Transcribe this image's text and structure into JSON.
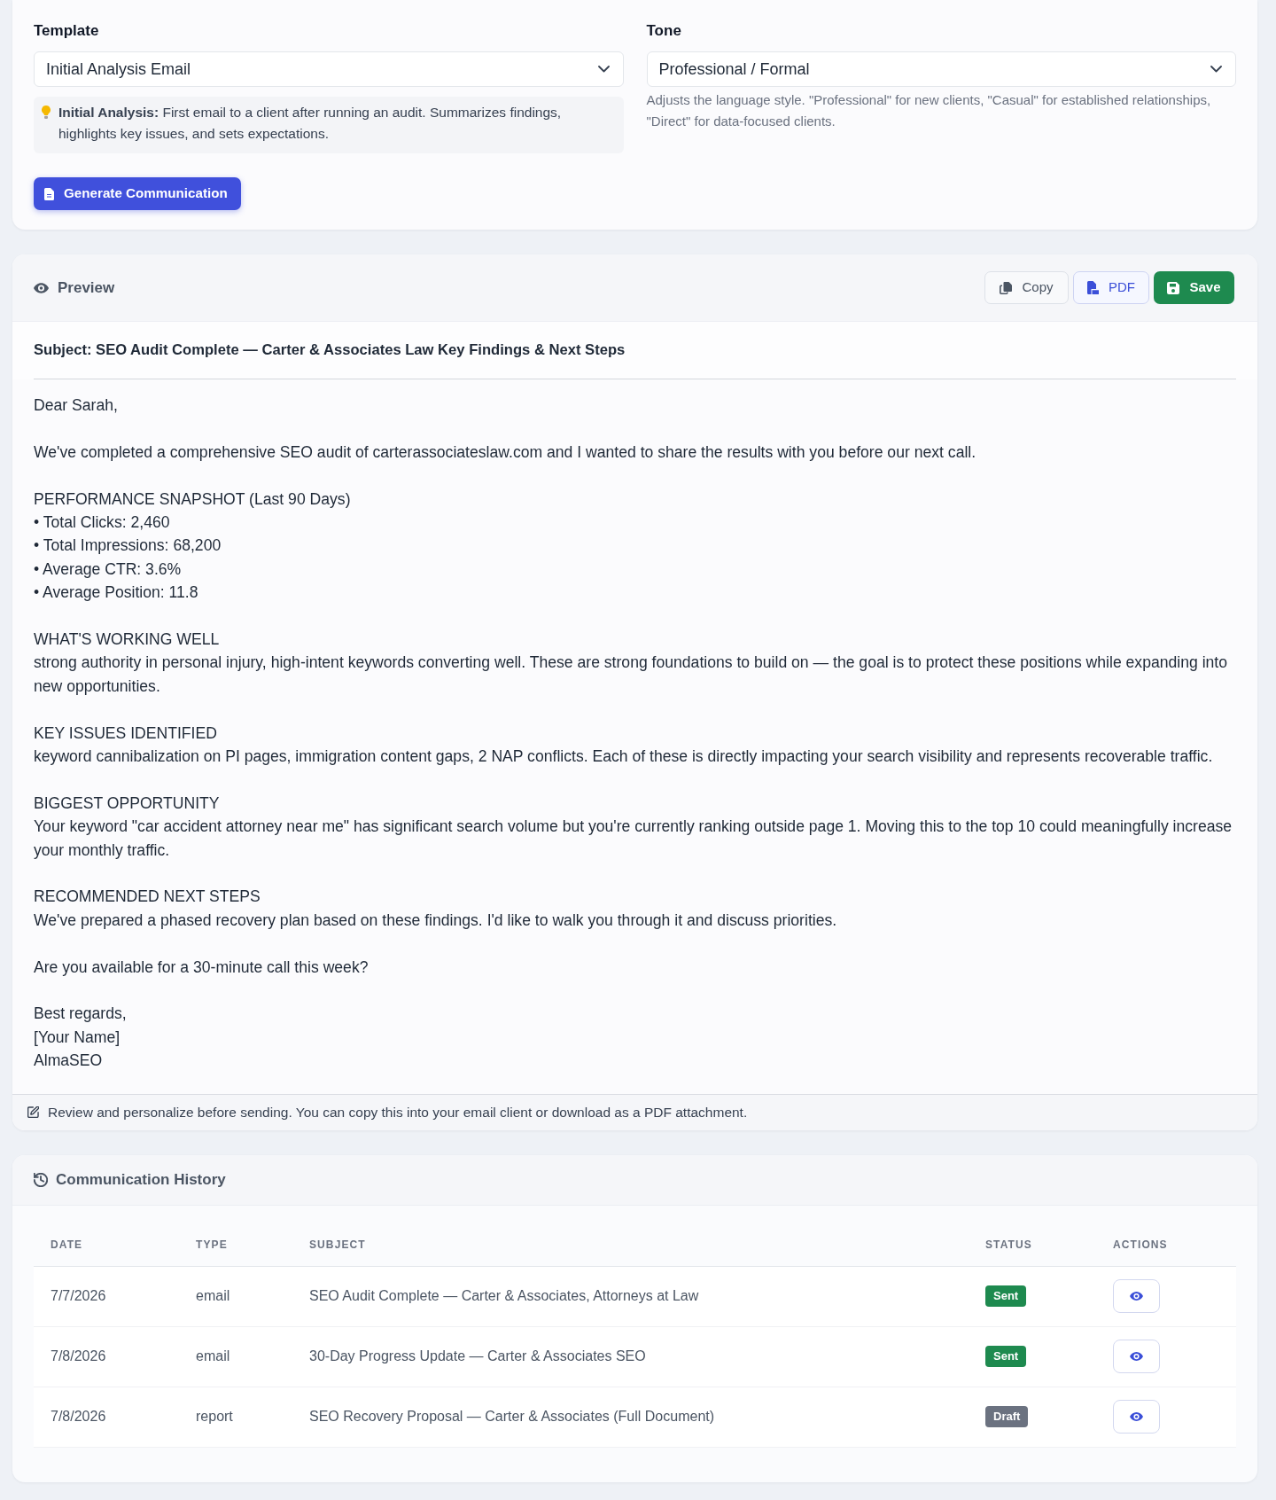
{
  "settings": {
    "template": {
      "label": "Template",
      "value": "Initial Analysis Email",
      "description": "**Initial Analysis:** First email to a client after running an audit. Summarizes findings, highlights key issues, and sets expectations."
    },
    "tone": {
      "label": "Tone",
      "value": "Professional / Formal",
      "help": "Adjusts the language style. \"Professional\" for new clients, \"Casual\" for established relationships, \"Direct\" for data-focused clients."
    },
    "generate_button": "Generate Communication"
  },
  "preview": {
    "title": "Preview",
    "actions": [
      {
        "kind": "copy",
        "label": "Copy"
      },
      {
        "kind": "pdf",
        "label": "PDF"
      },
      {
        "kind": "save",
        "label": "Save"
      }
    ],
    "subject": "Subject: SEO Audit Complete — Carter & Associates Law Key Findings & Next Steps",
    "body": [
      [
        "Dear Sarah,"
      ],
      [
        "We've completed a comprehensive SEO audit of carterassociateslaw.com and I wanted to share the results with you before our next call."
      ],
      [
        "PERFORMANCE SNAPSHOT (Last 90 Days)",
        "• Total Clicks: 2,460",
        "• Total Impressions: 68,200",
        "• Average CTR: 3.6%",
        "• Average Position: 11.8"
      ],
      [
        "WHAT'S WORKING WELL",
        "strong authority in personal injury, high-intent keywords converting well. These are strong foundations to build on — the goal is to protect these positions while expanding into new opportunities."
      ],
      [
        "KEY ISSUES IDENTIFIED",
        "keyword cannibalization on PI pages, immigration content gaps, 2 NAP conflicts. Each of these is directly impacting your search visibility and represents recoverable traffic."
      ],
      [
        "BIGGEST OPPORTUNITY",
        "Your keyword \"car accident attorney near me\" has significant search volume but you're currently ranking outside page 1. Moving this to the top 10 could meaningfully increase your monthly traffic."
      ],
      [
        "RECOMMENDED NEXT STEPS",
        "We've prepared a phased recovery plan based on these findings. I'd like to walk you through it and discuss priorities."
      ],
      [
        "Are you available for a 30-minute call this week?"
      ],
      [
        "Best regards,",
        "[Your Name]",
        "AlmaSEO"
      ]
    ],
    "note": "Review and personalize before sending. You can copy this into your email client or download as a PDF attachment."
  },
  "history": {
    "title": "Communication History",
    "columns": [
      "DATE",
      "TYPE",
      "SUBJECT",
      "STATUS",
      "ACTIONS"
    ],
    "rows": [
      {
        "date": "7/7/2026",
        "type": "email",
        "subject": "SEO Audit Complete — Carter & Associates, Attorneys at Law",
        "status": "Sent",
        "color": "#1e8a4f"
      },
      {
        "date": "7/8/2026",
        "type": "email",
        "subject": "30-Day Progress Update — Carter & Associates SEO",
        "status": "Sent",
        "color": "#1e8a4f"
      },
      {
        "date": "7/8/2026",
        "type": "report",
        "subject": "SEO Recovery Proposal — Carter & Associates (Full Document)",
        "status": "Draft",
        "color": "#6b7280"
      }
    ]
  }
}
